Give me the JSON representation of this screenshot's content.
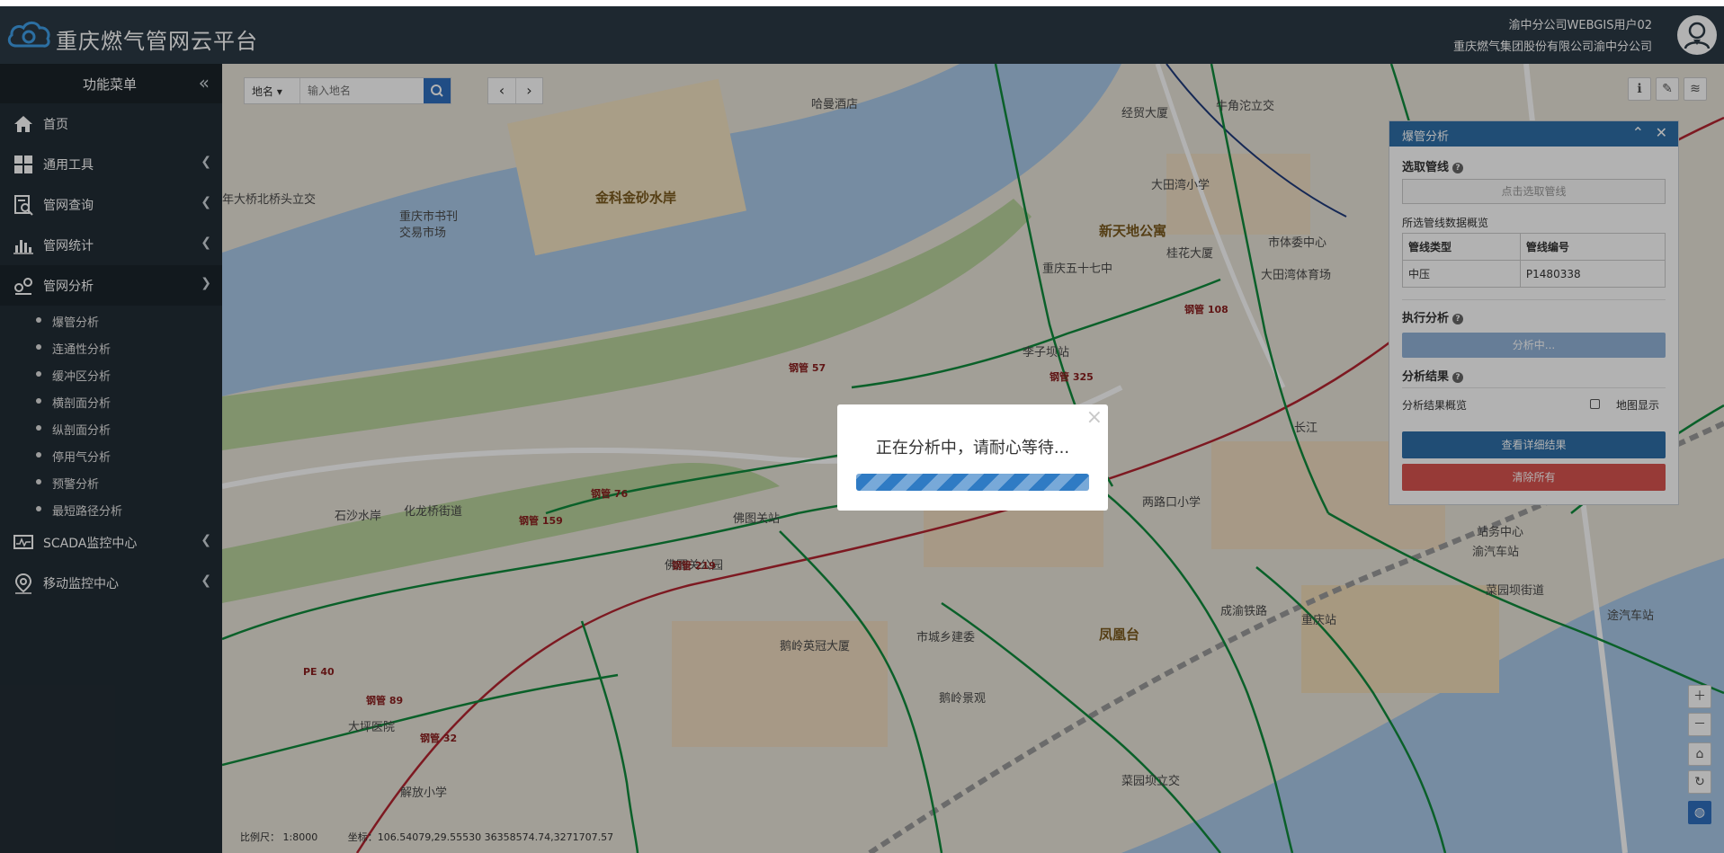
{
  "header": {
    "app_title": "重庆燃气管网云平台",
    "user_name": "渝中分公司WEBGIS用户02",
    "company": "重庆燃气集团股份有限公司渝中分公司"
  },
  "sidebar": {
    "menu_title": "功能菜单",
    "collapse_glyph": "«",
    "items": [
      {
        "label": "首页",
        "icon": "home-icon"
      },
      {
        "label": "通用工具",
        "icon": "grid-icon"
      },
      {
        "label": "管网查询",
        "icon": "query-icon"
      },
      {
        "label": "管网统计",
        "icon": "bar-chart-icon"
      },
      {
        "label": "管网分析",
        "icon": "analysis-icon"
      },
      {
        "label": "SCADA监控中心",
        "icon": "monitor-icon"
      },
      {
        "label": "移动监控中心",
        "icon": "location-icon"
      }
    ],
    "sub_items": [
      "爆管分析",
      "连通性分析",
      "缓冲区分析",
      "横剖面分析",
      "纵剖面分析",
      "停用气分析",
      "预警分析",
      "最短路径分析"
    ]
  },
  "map": {
    "search_type": "地名",
    "search_placeholder": "输入地名",
    "scale_text": "比例尺：  1:8000",
    "coord_text": "坐标：106.54079,29.55530    36358574.74,3271707.57",
    "labels": {
      "l1": "哈曼酒店",
      "l2": "金科金砂水岸",
      "l3": "重庆市书刊",
      "l3b": "交易市场",
      "l4": "年大桥北桥头立交",
      "l5": "经贸大厦",
      "l6": "牛角沱立交",
      "l7": "大田湾小学",
      "l8": "新天地公寓",
      "l9": "桂花大厦",
      "l10": "市体委中心",
      "l11": "重庆五十七中",
      "l12": "大田湾体育场",
      "l13": "李子坝站",
      "l14": "化龙桥街道",
      "l15": "佛图关站",
      "l16": "佛图关公园",
      "l17": "两路口小学",
      "l18": "鹅岭英冠大厦",
      "l19": "市城乡建委",
      "l20": "凤凰台",
      "l21": "重庆站",
      "l22": "菜园坝街道",
      "l23": "大坪医院",
      "l24": "解放小学",
      "l25": "菜园坝立交",
      "l26": "长江",
      "l27": "成渝铁路",
      "l28": "鹅岭景观",
      "l29": "石沙水岸",
      "l30": "渝汽车站",
      "l31": "站务中心",
      "l32": "途汽车站"
    },
    "pipe_labels": [
      "钢管 57",
      "钢管 108",
      "钢管 325",
      "钢管 219",
      "钢管 76",
      "钢管 89",
      "钢管 159",
      "PE 40",
      "钢管 32"
    ]
  },
  "panel": {
    "title": "爆管分析",
    "select_pipe_title": "选取管线",
    "pick_button": "点击选取管线",
    "summary_title": "所选管线数据概览",
    "table_headers": [
      "管线类型",
      "管线编号"
    ],
    "table_row": [
      "中压",
      "P1480338"
    ],
    "run_title": "执行分析",
    "run_button": "分析中...",
    "result_title": "分析结果",
    "result_overview": "分析结果概览",
    "map_display": "地图显示",
    "detail_button": "查看详细结果",
    "clear_button": "清除所有"
  },
  "modal": {
    "message": "正在分析中，请耐心等待...",
    "close_glyph": "×",
    "progress": 1.0
  },
  "colors": {
    "header_bg": "#2c3a46",
    "sidebar_bg": "#222d35",
    "accent_blue": "#2f6fa8",
    "pipe_green": "#0f8a3c",
    "railway_red": "#b32430",
    "river_blue": "#a9c9e8"
  }
}
